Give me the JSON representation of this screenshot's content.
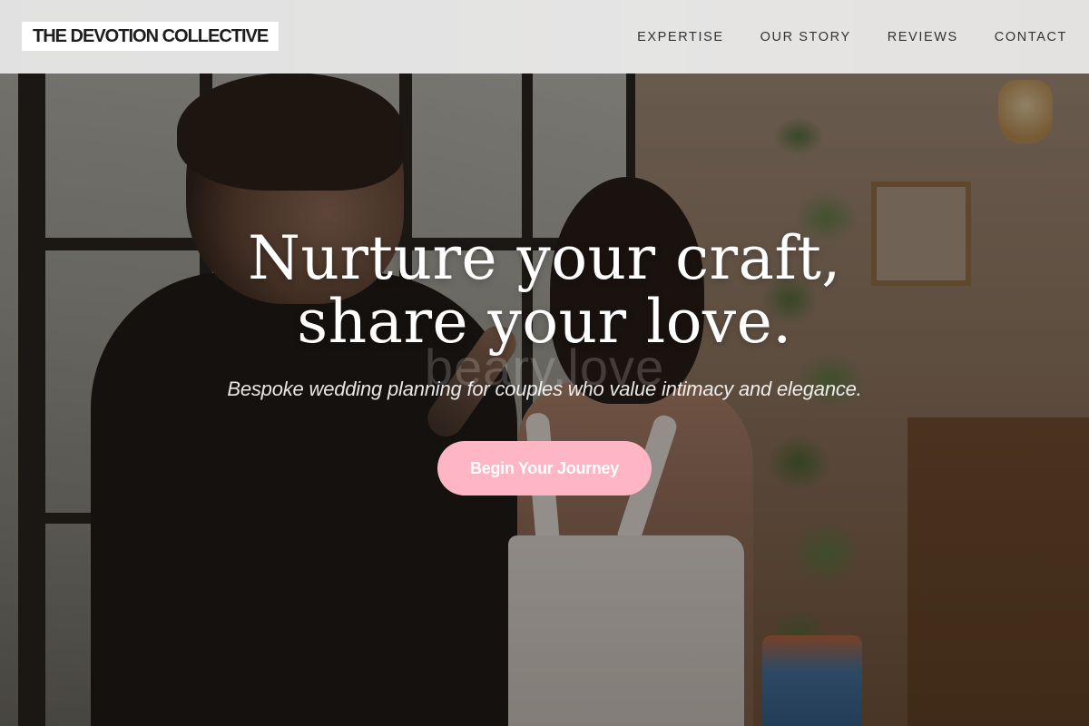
{
  "header": {
    "logo_text": "THE DEVOTION COLLECTIVE",
    "nav": [
      {
        "label": "EXPERTISE"
      },
      {
        "label": "OUR STORY"
      },
      {
        "label": "REVIEWS"
      },
      {
        "label": "CONTACT"
      }
    ]
  },
  "hero": {
    "headline_line1": "Nurture your craft,",
    "headline_line2": "share your love.",
    "watermark": "beary.love",
    "subheadline": "Bespoke wedding planning for couples who value intimacy and elegance.",
    "cta_label": "Begin Your Journey"
  },
  "colors": {
    "cta_background": "#ffb6c4",
    "header_background": "#f0f0f0",
    "text_light": "#ffffff",
    "text_dark": "#333333"
  }
}
